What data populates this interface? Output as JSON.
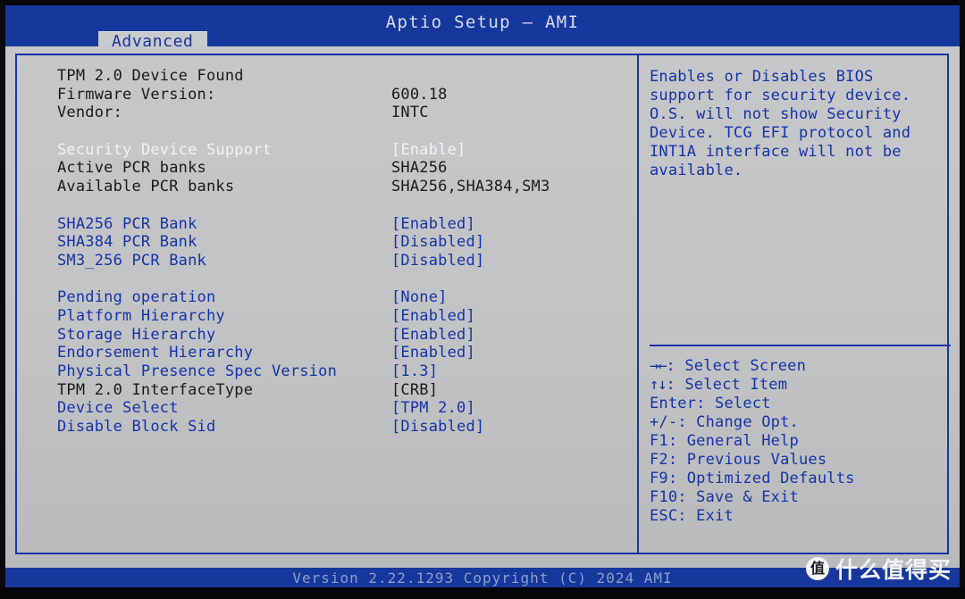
{
  "window": {
    "app_title": "Aptio Setup – AMI",
    "colors": {
      "title_bar_blue": "#16379b",
      "body_gray": "#c2c3c5",
      "accent_blue": "#1533a8",
      "border_blue": "#1a34a4",
      "highlight_white": "#f2f3f5",
      "static_dark": "#1a1a1c"
    }
  },
  "tabs": [
    {
      "label": "Advanced",
      "active": true
    }
  ],
  "settings": [
    {
      "label": "TPM 2.0 Device Found",
      "value": "",
      "label_color": "dark",
      "value_color": "dark"
    },
    {
      "label": "Firmware Version:",
      "value": "600.18",
      "label_color": "dark",
      "value_color": "dark"
    },
    {
      "label": "Vendor:",
      "value": "INTC",
      "label_color": "dark",
      "value_color": "dark"
    },
    {
      "spacer": true
    },
    {
      "label": "Security Device Support",
      "value": "[Enable]",
      "label_color": "white",
      "value_color": "white",
      "selected": true
    },
    {
      "label": "Active PCR banks",
      "value": "SHA256",
      "label_color": "dark",
      "value_color": "dark"
    },
    {
      "label": "Available PCR banks",
      "value": "SHA256,SHA384,SM3",
      "label_color": "dark",
      "value_color": "dark"
    },
    {
      "spacer": true
    },
    {
      "label": "SHA256 PCR Bank",
      "value": "[Enabled]",
      "label_color": "blue",
      "value_color": "blue"
    },
    {
      "label": "SHA384 PCR Bank",
      "value": "[Disabled]",
      "label_color": "blue",
      "value_color": "blue"
    },
    {
      "label": "SM3_256 PCR Bank",
      "value": "[Disabled]",
      "label_color": "blue",
      "value_color": "blue"
    },
    {
      "spacer": true
    },
    {
      "label": "Pending operation",
      "value": "[None]",
      "label_color": "blue",
      "value_color": "blue"
    },
    {
      "label": "Platform Hierarchy",
      "value": "[Enabled]",
      "label_color": "blue",
      "value_color": "blue"
    },
    {
      "label": "Storage Hierarchy",
      "value": "[Enabled]",
      "label_color": "blue",
      "value_color": "blue"
    },
    {
      "label": "Endorsement Hierarchy",
      "value": "[Enabled]",
      "label_color": "blue",
      "value_color": "blue"
    },
    {
      "label": "Physical Presence Spec Version",
      "value": "[1.3]",
      "label_color": "blue",
      "value_color": "blue"
    },
    {
      "label": "TPM 2.0 InterfaceType",
      "value": "[CRB]",
      "label_color": "dark",
      "value_color": "dark"
    },
    {
      "label": "Device Select",
      "value": "[TPM 2.0]",
      "label_color": "blue",
      "value_color": "blue"
    },
    {
      "label": "Disable Block Sid",
      "value": "[Disabled]",
      "label_color": "blue",
      "value_color": "blue"
    }
  ],
  "help": {
    "lines": [
      "Enables or Disables BIOS",
      "support for security device.",
      "O.S. will not show Security",
      "Device. TCG EFI protocol and",
      "INT1A interface will not be",
      "available."
    ]
  },
  "key_legend": [
    {
      "glyph": "→←",
      "text": ": Select Screen"
    },
    {
      "glyph": "↑↓",
      "text": ": Select Item"
    },
    {
      "glyph": "",
      "text": "Enter: Select"
    },
    {
      "glyph": "",
      "text": "+/-: Change Opt."
    },
    {
      "glyph": "",
      "text": "F1: General Help"
    },
    {
      "glyph": "",
      "text": "F2: Previous Values"
    },
    {
      "glyph": "",
      "text": "F9: Optimized Defaults"
    },
    {
      "glyph": "",
      "text": "F10: Save & Exit"
    },
    {
      "glyph": "",
      "text": "ESC: Exit"
    }
  ],
  "footer": {
    "version_text": "Version 2.22.1293 Copyright (C) 2024 AMI"
  },
  "watermark": {
    "badge": "值",
    "text": "什么值得买"
  }
}
